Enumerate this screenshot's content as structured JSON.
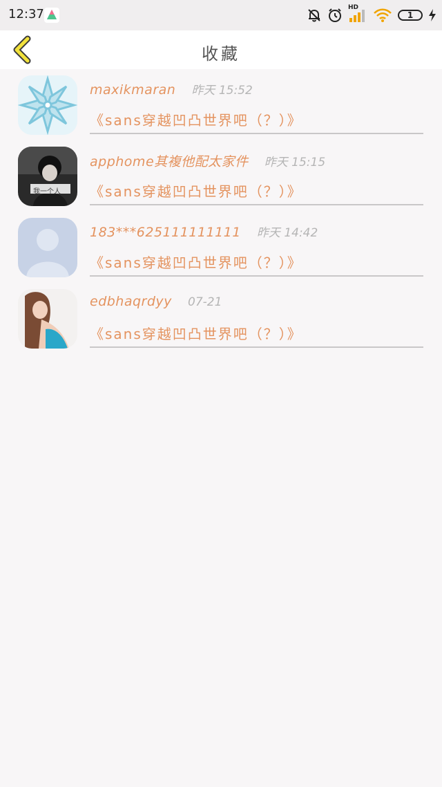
{
  "status_bar": {
    "time": "12:37",
    "network_label": "HD",
    "battery_level": "1",
    "icons": [
      "app-notification-icon",
      "mute-bell-icon",
      "alarm-icon",
      "signal-icon",
      "wifi-icon",
      "battery-icon",
      "charging-icon"
    ]
  },
  "header": {
    "title": "收藏",
    "back_icon": "chevron-left-icon",
    "accent_color": "#f2e23c"
  },
  "favorites": [
    {
      "username": "maxikmaran",
      "time": "昨天 15:52",
      "title": "《sans穿越凹凸世界吧（？）》",
      "avatar": "snowflake-pattern"
    },
    {
      "username": "apphome其複他配太家件",
      "time": "昨天 15:15",
      "title": "《sans穿越凹凸世界吧（？）》",
      "avatar": "person-photo-bw",
      "avatar_caption": "我一个人"
    },
    {
      "username": "183***625111111111",
      "time": "昨天 14:42",
      "title": "《sans穿越凹凸世界吧（？）》",
      "avatar": "default-person"
    },
    {
      "username": "edbhaqrdyy",
      "time": "07-21",
      "title": "《sans穿越凹凸世界吧（？）》",
      "avatar": "woman-photo"
    }
  ],
  "colors": {
    "accent_orange": "#e4935f",
    "time_gray": "#b5b5b5",
    "background": "#f8f6f7"
  }
}
